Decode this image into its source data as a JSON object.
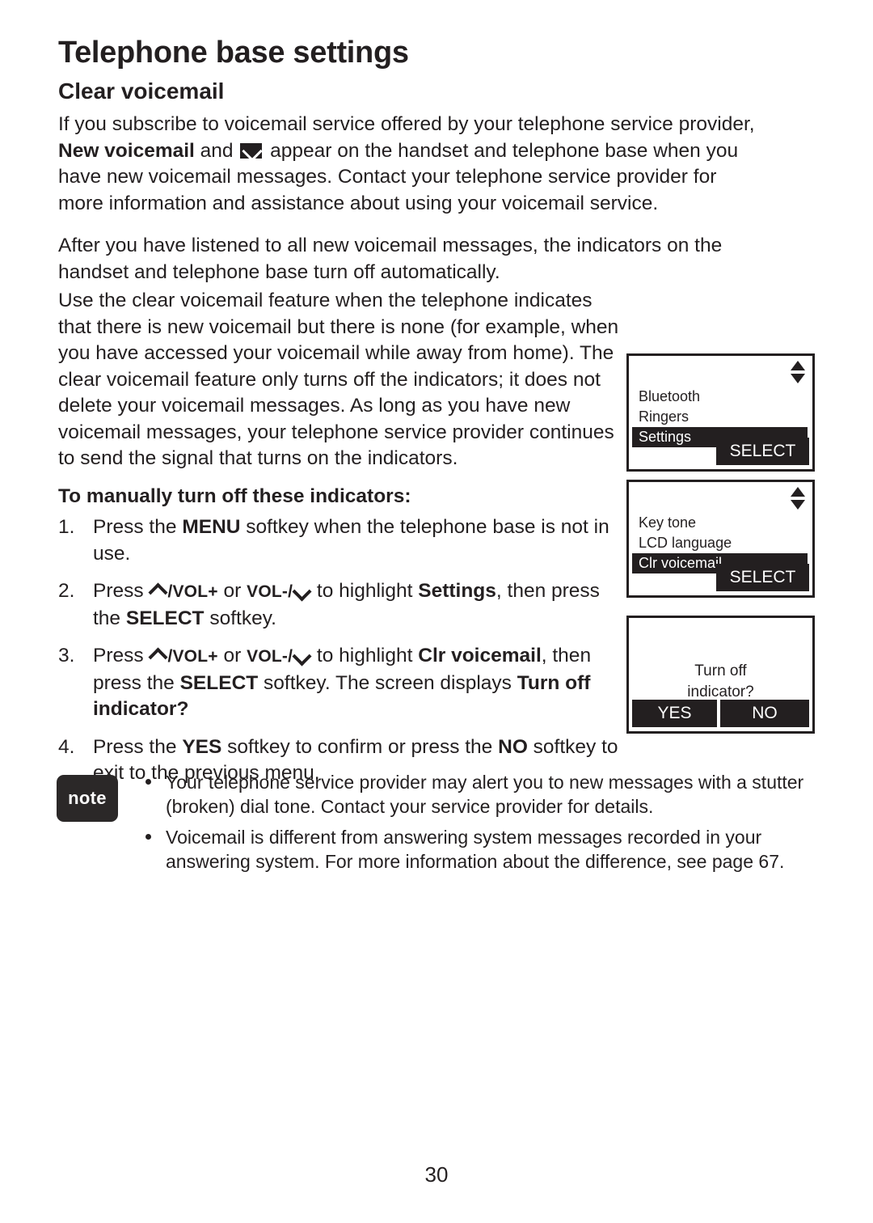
{
  "document": {
    "chapter_title": "Telephone base settings",
    "section_title": "Clear voicemail",
    "page_number": "30"
  },
  "paragraphs": {
    "p1_a": "If you subscribe to voicemail service offered by your telephone service provider, ",
    "p1_bold": "New voicemail",
    "p1_b": " and ",
    "p1_icon": "envelope-icon",
    "p1_c": " appear on the handset and telephone base when you have new voicemail messages. Contact your telephone service provider for more information and assistance about using your voicemail service.",
    "p2": "After you have listened to all new voicemail messages, the indicators on the handset and telephone base turn off automatically.",
    "p3": "Use the clear voicemail feature when the telephone indicates that there is new voicemail but there is none (for example, when you have accessed your voicemail while away from home). The clear voicemail feature only turns off the indicators; it does not delete your voicemail messages. As long as you have new voicemail messages, your telephone service provider continues to send the signal that turns on the indicators."
  },
  "procedure": {
    "heading": "To manually turn off these indicators:",
    "steps": [
      {
        "num": "1.",
        "a": "Press the ",
        "bold1": "MENU",
        "b": " softkey when the telephone base is not in use."
      },
      {
        "num": "2.",
        "a": "Press ",
        "vol_up": "/VOL+",
        "mid": " or ",
        "vol_down": "VOL-/",
        "b": " to highlight ",
        "bold1": "Settings",
        "c": ", then press the ",
        "bold2": "SELECT",
        "d": " softkey."
      },
      {
        "num": "3.",
        "a": "Press ",
        "vol_up": "/VOL+",
        "mid": " or ",
        "vol_down": "VOL-/",
        "b": " to highlight ",
        "bold1": "Clr voicemail",
        "c": ", then press the ",
        "bold2": "SELECT",
        "d": " softkey. The screen displays ",
        "bold3": "Turn off indicator?"
      },
      {
        "num": "4.",
        "a": "Press the ",
        "bold1": "YES",
        "b": " softkey to confirm or press the ",
        "bold2": "NO",
        "c": " softkey to exit to the previous menu."
      }
    ]
  },
  "screens": [
    {
      "name": "main-menu-screen",
      "scroll_indicator": "up-down-arrows-icon",
      "items": [
        "Bluetooth",
        "Ringers",
        "Settings"
      ],
      "selected_index": 2,
      "softkeys": [
        {
          "label": "SELECT",
          "position": "right"
        }
      ]
    },
    {
      "name": "settings-menu-screen",
      "scroll_indicator": "up-down-arrows-icon",
      "items": [
        "Key tone",
        "LCD language",
        "Clr voicemail"
      ],
      "selected_index": 2,
      "softkeys": [
        {
          "label": "SELECT",
          "position": "right"
        }
      ]
    },
    {
      "name": "confirm-dialog-screen",
      "prompt_line1": "Turn off",
      "prompt_line2": "indicator?",
      "softkeys": [
        {
          "label": "YES",
          "position": "left"
        },
        {
          "label": "NO",
          "position": "right"
        }
      ]
    }
  ],
  "note": {
    "badge": "note",
    "items": [
      "Your telephone service provider may alert you to new messages with a stutter (broken) dial tone. Contact your service provider for details.",
      "Voicemail is different from answering system messages recorded in your answering system. For more information about the difference, see page 67."
    ]
  },
  "colors": {
    "ink": "#231f20",
    "note_badge_bg": "#2b2828",
    "lcd_highlight": "#231f20"
  }
}
